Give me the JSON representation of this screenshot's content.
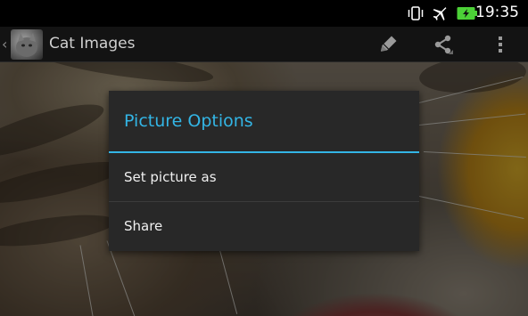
{
  "status_bar": {
    "time": "19:35",
    "icons": [
      "vibrate-icon",
      "airplane-mode-icon",
      "battery-charging-icon"
    ],
    "battery_color": "#4cd137"
  },
  "action_bar": {
    "title": "Cat Images",
    "actions": [
      "edit-icon",
      "share-icon",
      "overflow-menu-icon"
    ]
  },
  "dialog": {
    "title": "Picture Options",
    "accent_color": "#33b5e5",
    "items": [
      {
        "label": "Set picture as"
      },
      {
        "label": "Share"
      }
    ]
  }
}
